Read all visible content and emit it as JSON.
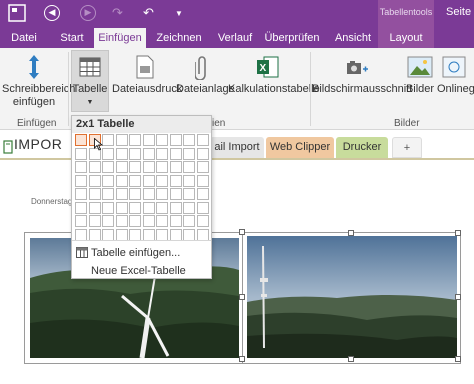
{
  "titlebar": {
    "context_title": "Tabellentools",
    "page_label": "Seite"
  },
  "tabs": [
    {
      "label": "Datei"
    },
    {
      "label": "Start"
    },
    {
      "label": "Einfügen"
    },
    {
      "label": "Zeichnen"
    },
    {
      "label": "Verlauf"
    },
    {
      "label": "Überprüfen"
    },
    {
      "label": "Ansicht"
    },
    {
      "label": "Layout"
    }
  ],
  "ribbon": {
    "schreibbereich": "Schreibbereich einfügen",
    "tabelle": "Tabelle",
    "dateiausdruck": "Dateiausdruck",
    "dateianlage": "Dateianlage",
    "kalkulationstabelle": "Kalkulationstabelle",
    "bildschirmausschnitt": "Bildschirmausschnitt",
    "bilder": "Bilder",
    "onlinebilder": "Onlinegr",
    "group_einfuegen": "Einfügen",
    "group_dateien": "ien",
    "group_bilder": "Bilder"
  },
  "sections": {
    "notebook": "IMPOR",
    "mail_import": "ail Import",
    "web_clipper": "Web Clipper",
    "drucker": "Drucker",
    "add": "+"
  },
  "page": {
    "date": "Donnerstag,"
  },
  "dropdown": {
    "header": "2x1 Tabelle",
    "insert_table": "Tabelle einfügen...",
    "new_excel": "Neue Excel-Tabelle"
  },
  "colors": {
    "accent": "#7b3a96",
    "tab_web_clipper": "#f0c8a0",
    "tab_drucker": "#c8dc9c"
  }
}
